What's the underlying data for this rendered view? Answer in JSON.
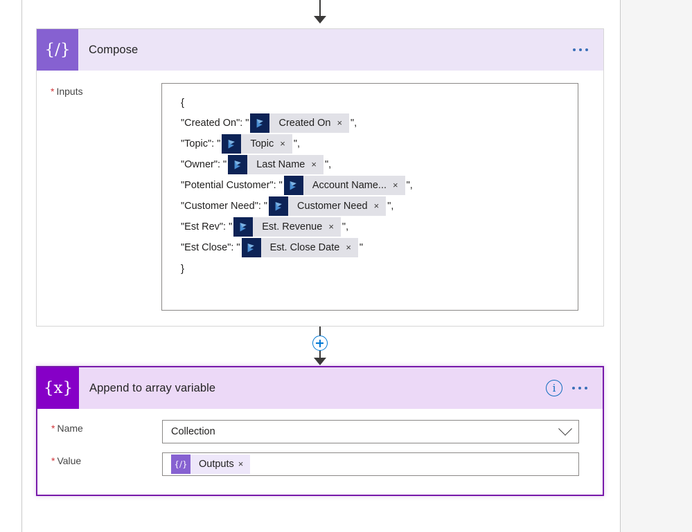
{
  "compose_card": {
    "icon_name": "compose-icon",
    "icon_glyph": "{∕}",
    "title": "Compose",
    "menu_icon": "ellipsis-icon",
    "inputs_label": "Inputs",
    "required_marker": "*",
    "json": {
      "open_brace": "{",
      "close_brace": "}",
      "lines": [
        {
          "key": "\"Created On\": \"",
          "token": "Created On",
          "suffix": "\","
        },
        {
          "key": "\"Topic\": \"",
          "token": "Topic",
          "suffix": "\","
        },
        {
          "key": "\"Owner\": \"",
          "token": "Last Name",
          "suffix": "\","
        },
        {
          "key": "\"Potential Customer\": \"",
          "token": "Account Name...",
          "suffix": "\","
        },
        {
          "key": "\"Customer Need\": \"",
          "token": "Customer Need",
          "suffix": "\","
        },
        {
          "key": "\"Est Rev\": \"",
          "token": "Est. Revenue",
          "suffix": "\","
        },
        {
          "key": "\"Est Close\": \"",
          "token": "Est. Close Date",
          "suffix": "\""
        }
      ],
      "token_icon_name": "dataverse-icon",
      "token_remove_label": "×"
    }
  },
  "connector": {
    "add_step_label": "+",
    "add_step_name": "add-step-button"
  },
  "append_card": {
    "icon_name": "variable-icon",
    "icon_glyph": "{x}",
    "title": "Append to array variable",
    "info_icon": "info-icon",
    "info_glyph": "i",
    "menu_icon": "ellipsis-icon",
    "selected": true,
    "name_field": {
      "label": "Name",
      "required_marker": "*",
      "value": "Collection",
      "chevron_icon": "chevron-down-icon"
    },
    "value_field": {
      "label": "Value",
      "required_marker": "*",
      "token": "Outputs",
      "token_icon_name": "compose-output-icon",
      "token_icon_glyph": "{∕}",
      "token_remove_label": "×"
    }
  },
  "colors": {
    "compose_header_bg": "#ece4f7",
    "compose_icon_bg": "#8661d1",
    "variable_icon_bg": "#8600c7",
    "selected_border": "#7719aa",
    "dataverse_navy": "#0d2356",
    "accent_blue": "#0078d4",
    "required_red": "#d13438"
  }
}
